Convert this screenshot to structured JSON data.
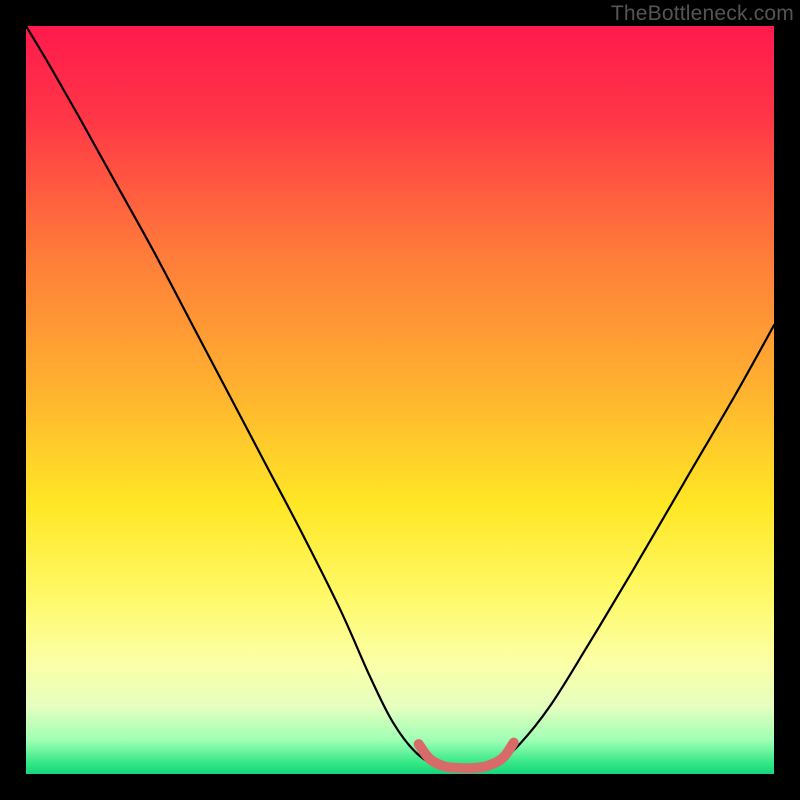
{
  "watermark": "TheBottleneck.com",
  "chart_data": {
    "type": "line",
    "title": "",
    "xlabel": "",
    "ylabel": "",
    "xlim": [
      0,
      100
    ],
    "ylim": [
      0,
      100
    ],
    "grid": false,
    "legend": false,
    "background_gradient": {
      "stops": [
        {
          "offset": 0.0,
          "color": "#ff1a4d"
        },
        {
          "offset": 0.12,
          "color": "#ff3547"
        },
        {
          "offset": 0.3,
          "color": "#ff7a3a"
        },
        {
          "offset": 0.48,
          "color": "#ffb030"
        },
        {
          "offset": 0.64,
          "color": "#ffe725"
        },
        {
          "offset": 0.76,
          "color": "#fff966"
        },
        {
          "offset": 0.85,
          "color": "#fbffa6"
        },
        {
          "offset": 0.91,
          "color": "#e5ffbf"
        },
        {
          "offset": 0.955,
          "color": "#9fffb5"
        },
        {
          "offset": 0.985,
          "color": "#35e886"
        },
        {
          "offset": 1.0,
          "color": "#17d47a"
        }
      ]
    },
    "series": [
      {
        "name": "bottleneck-curve",
        "stroke": "#000000",
        "stroke_width": 2.2,
        "x": [
          0.0,
          3,
          7,
          12,
          17,
          22,
          27,
          32,
          37,
          42,
          46,
          49,
          52,
          55,
          57.5,
          60,
          63,
          66,
          70,
          75,
          81,
          88,
          95,
          100
        ],
        "y": [
          100,
          95,
          88,
          79,
          70,
          60.5,
          51,
          41.5,
          32,
          22,
          13,
          7,
          3,
          1,
          0.5,
          0.5,
          1.5,
          4,
          9,
          17,
          27,
          39,
          51,
          60
        ]
      }
    ],
    "highlight": {
      "name": "sweet-spot",
      "stroke": "#d86a6a",
      "stroke_width": 10,
      "linecap": "round",
      "x": [
        52.5,
        54,
        56,
        58,
        60,
        62,
        63.8,
        65.2
      ],
      "y": [
        4.0,
        2.0,
        1.0,
        0.8,
        0.8,
        1.2,
        2.2,
        4.2
      ]
    }
  }
}
